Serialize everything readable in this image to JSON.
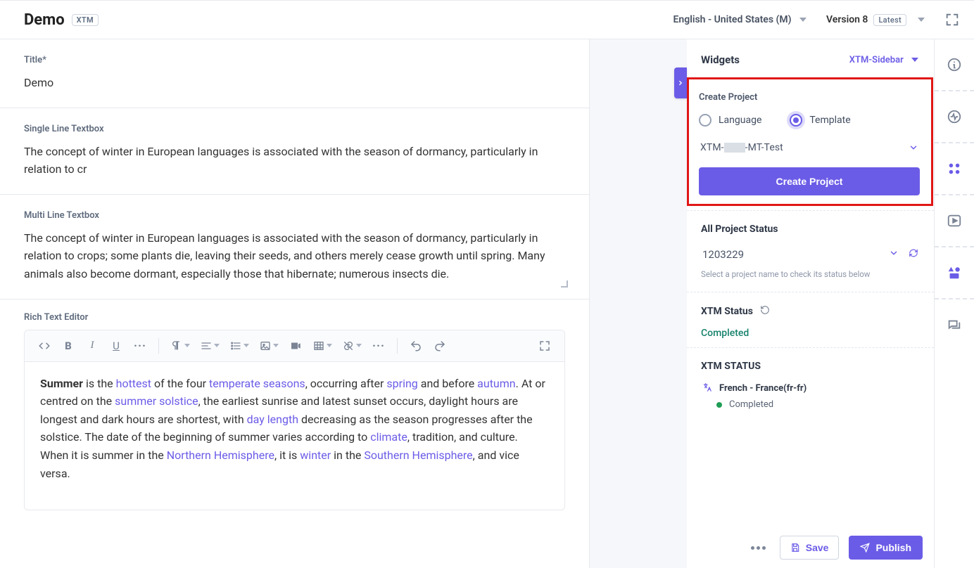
{
  "header": {
    "page_title": "Demo",
    "app_chip": "XTM",
    "language_selector": "English - United States (M)",
    "version_label": "Version 8",
    "version_chip": "Latest"
  },
  "fields": {
    "title_label": "Title*",
    "title_value": "Demo",
    "single_line_label": "Single Line Textbox",
    "single_line_value": "The concept of winter in European languages is associated with the season of dormancy, particularly in relation to cr",
    "multi_line_label": "Multi Line Textbox",
    "multi_line_value": "The concept of winter in European languages is associated with the season of dormancy, particularly in relation to crops; some plants die, leaving their seeds, and others merely cease growth until spring. Many animals also become dormant, especially those that hibernate; numerous insects die.",
    "rte_label": "Rich Text Editor",
    "rte_links": {
      "hottest": "hottest",
      "temperate": "temperate seasons",
      "spring": "spring",
      "autumn": "autumn",
      "summer_solstice": "summer solstice",
      "day_length": "day length",
      "climate": "climate",
      "northern": "Northern Hemisphere",
      "winter": "winter",
      "southern": "Southern Hemisphere"
    },
    "rte_text": {
      "p1a": "Summer",
      "p1b": " is the ",
      "p1c": " of the four ",
      "p1d": ", occurring after ",
      "p1e": " and before ",
      "p1f": ". At or centred on the ",
      "p1g": ", the earliest sunrise and latest sunset occurs, daylight hours are longest and dark hours are shortest, with ",
      "p1h": " decreasing as the season progresses after the solstice. The date of the beginning of summer varies according to ",
      "p1i": ", tradition, and culture. When it is summer in the ",
      "p1j": ", it is ",
      "p1k": " in the ",
      "p1l": ", and vice versa."
    }
  },
  "widgets": {
    "heading": "Widgets",
    "selector": "XTM-Sidebar",
    "create_project": {
      "title": "Create Project",
      "option_language": "Language",
      "option_template": "Template",
      "template_prefix": "XTM-",
      "template_suffix": "-MT-Test",
      "button_label": "Create Project"
    },
    "all_status": {
      "title": "All Project Status",
      "project_id": "1203229",
      "help_text": "Select a project name to check its status below"
    },
    "xtm_status": {
      "title": "XTM Status",
      "value": "Completed"
    },
    "xtm_status_list": {
      "title": "XTM STATUS",
      "language": "French - France(fr-fr)",
      "status": "Completed"
    }
  },
  "footer": {
    "save": "Save",
    "publish": "Publish"
  }
}
